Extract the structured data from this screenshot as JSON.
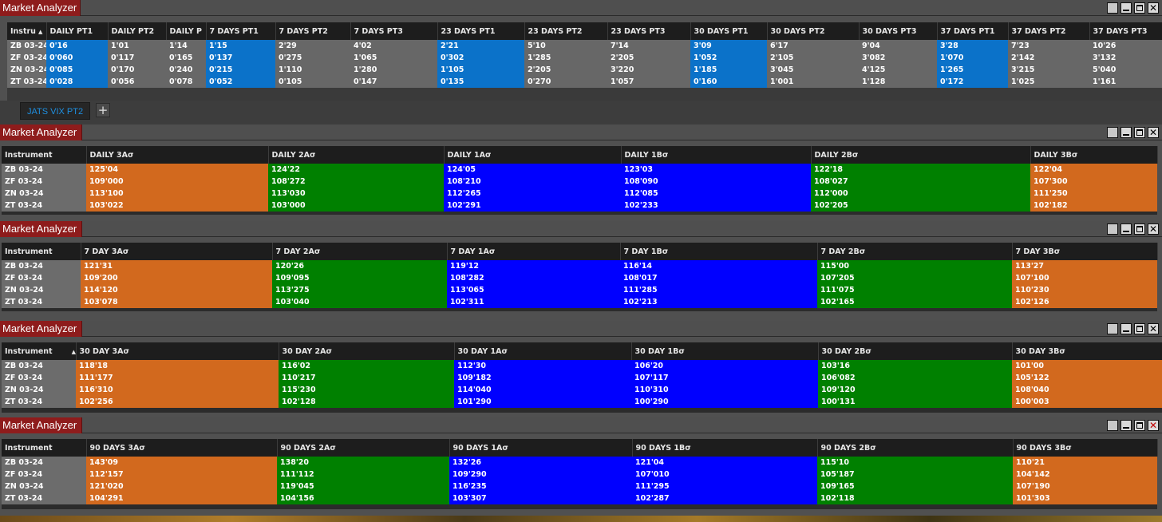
{
  "window_title": "Market Analyzer",
  "w1": {
    "headers": [
      "Instru",
      "DAILY PT1",
      "DAILY PT2",
      "DAILY P",
      "7 DAYS PT1",
      "7 DAYS PT2",
      "7 DAYS PT3",
      "23 DAYS PT1",
      "23 DAYS PT2",
      "23 DAYS PT3",
      "30 DAYS PT1",
      "30 DAYS PT2",
      "30 DAYS PT3",
      "37 DAYS PT1",
      "37 DAYS PT2",
      "37 DAYS PT3"
    ],
    "rows": [
      [
        "ZB 03-24",
        "0'16",
        "1'01",
        "1'14",
        "1'15",
        "2'29",
        "4'02",
        "2'21",
        "5'10",
        "7'14",
        "3'09",
        "6'17",
        "9'04",
        "3'28",
        "7'23",
        "10'26"
      ],
      [
        "ZF 03-24",
        "0'060",
        "0'117",
        "0'165",
        "0'137",
        "0'275",
        "1'065",
        "0'302",
        "1'285",
        "2'205",
        "1'052",
        "2'105",
        "3'082",
        "1'070",
        "2'142",
        "3'132"
      ],
      [
        "ZN 03-24",
        "0'085",
        "0'170",
        "0'240",
        "0'215",
        "1'110",
        "1'280",
        "1'105",
        "2'205",
        "3'220",
        "1'185",
        "3'045",
        "4'125",
        "1'265",
        "3'215",
        "5'040"
      ],
      [
        "ZT 03-24",
        "0'028",
        "0'056",
        "0'078",
        "0'052",
        "0'105",
        "0'147",
        "0'135",
        "0'270",
        "1'057",
        "0'160",
        "1'001",
        "1'128",
        "0'172",
        "1'025",
        "1'161"
      ]
    ],
    "tab_label": "JATS VIX PT2",
    "tab_add": "+"
  },
  "w2": {
    "headers": [
      "Instrument",
      "DAILY 3Aσ",
      "DAILY 2Aσ",
      "DAILY 1Aσ",
      "DAILY 1Bσ",
      "DAILY 2Bσ",
      "DAILY 3Bσ"
    ],
    "rows": [
      [
        "ZB 03-24",
        "125'04",
        "124'22",
        "124'05",
        "123'03",
        "122'18",
        "122'04"
      ],
      [
        "ZF 03-24",
        "109'000",
        "108'272",
        "108'210",
        "108'090",
        "108'027",
        "107'300"
      ],
      [
        "ZN 03-24",
        "113'100",
        "113'030",
        "112'265",
        "112'085",
        "112'000",
        "111'250"
      ],
      [
        "ZT 03-24",
        "103'022",
        "103'000",
        "102'291",
        "102'233",
        "102'205",
        "102'182"
      ]
    ]
  },
  "w3": {
    "headers": [
      "Instrument",
      "7 DAY 3Aσ",
      "7 DAY 2Aσ",
      "7 DAY 1Aσ",
      "7 DAY 1Bσ",
      "7 DAY 2Bσ",
      "7 DAY 3Bσ"
    ],
    "rows": [
      [
        "ZB 03-24",
        "121'31",
        "120'26",
        "119'12",
        "116'14",
        "115'00",
        "113'27"
      ],
      [
        "ZF 03-24",
        "109'200",
        "109'095",
        "108'282",
        "108'017",
        "107'205",
        "107'100"
      ],
      [
        "ZN 03-24",
        "114'120",
        "113'275",
        "113'065",
        "111'285",
        "111'075",
        "110'230"
      ],
      [
        "ZT 03-24",
        "103'078",
        "103'040",
        "102'311",
        "102'213",
        "102'165",
        "102'126"
      ]
    ]
  },
  "w4": {
    "headers": [
      "Instrument",
      "30 DAY 3Aσ",
      "30 DAY 2Aσ",
      "30 DAY 1Aσ",
      "30 DAY 1Bσ",
      "30 DAY 2Bσ",
      "30 DAY 3Bσ"
    ],
    "rows": [
      [
        "ZB 03-24",
        "118'18",
        "116'02",
        "112'30",
        "106'20",
        "103'16",
        "101'00"
      ],
      [
        "ZF 03-24",
        "111'177",
        "110'217",
        "109'182",
        "107'117",
        "106'082",
        "105'122"
      ],
      [
        "ZN 03-24",
        "116'310",
        "115'230",
        "114'040",
        "110'310",
        "109'120",
        "108'040"
      ],
      [
        "ZT 03-24",
        "102'256",
        "102'128",
        "101'290",
        "100'290",
        "100'131",
        "100'003"
      ]
    ]
  },
  "w5": {
    "headers": [
      "Instrument",
      "90 DAYS 3Aσ",
      "90 DAYS 2Aσ",
      "90 DAYS 1Aσ",
      "90 DAYS 1Bσ",
      "90 DAYS 2Bσ",
      "90 DAYS 3Bσ"
    ],
    "rows": [
      [
        "ZB 03-24",
        "143'09",
        "138'20",
        "132'26",
        "121'04",
        "115'10",
        "110'21"
      ],
      [
        "ZF 03-24",
        "112'157",
        "111'112",
        "109'290",
        "107'010",
        "105'187",
        "104'142"
      ],
      [
        "ZN 03-24",
        "121'020",
        "119'045",
        "116'235",
        "111'295",
        "109'165",
        "107'190"
      ],
      [
        "ZT 03-24",
        "104'291",
        "104'156",
        "103'307",
        "102'287",
        "102'118",
        "101'303"
      ]
    ]
  },
  "colors": {
    "title_red": "#8e1c1c",
    "highlight_blue": "#0b72c9",
    "orange": "#d2691e",
    "green": "#008000",
    "blue": "#0000ff",
    "neutral_gray": "#676767"
  }
}
